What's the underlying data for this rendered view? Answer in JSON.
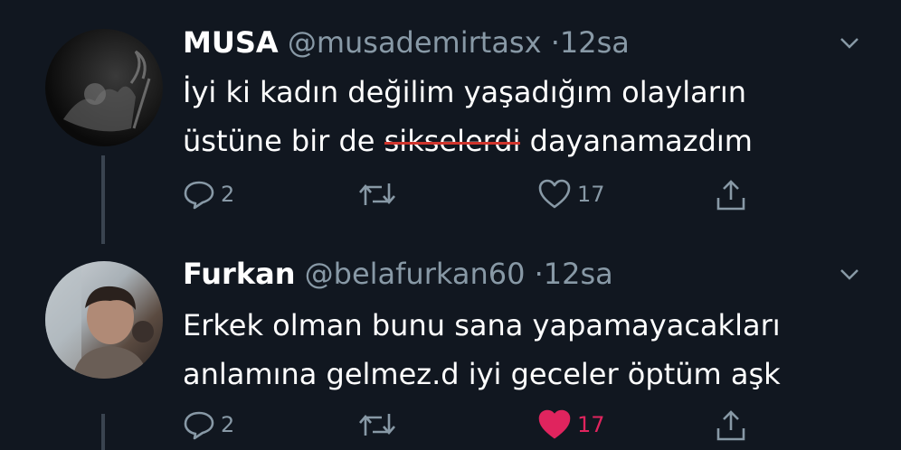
{
  "tweets": [
    {
      "name": "MUSA",
      "handle": "@musademirtasx",
      "separator": "·",
      "time": "12sa",
      "text_part1_line1": "İyi ki kadın değilim yaşadığım olayların",
      "text_part2_line2_prefix": "üstüne bir de ",
      "text_strike": "sikselerdi",
      "text_part3_line2_suffix": " dayanamazdım",
      "replies": "2",
      "likes": "17",
      "liked": false
    },
    {
      "name": "Furkan",
      "handle": "@belafurkan60",
      "separator": "·",
      "time": "12sa",
      "text_line1": "Erkek olman bunu sana yapamayacakları",
      "text_line2": "anlamına gelmez.d iyi geceler öptüm aşk",
      "replies": "2",
      "likes": "17",
      "liked": true
    }
  ],
  "colors": {
    "background": "#111720",
    "secondary_text": "#8899a6",
    "like_active": "#e0245e",
    "thread_line": "#3a4450"
  },
  "icons": [
    "reply-icon",
    "retweet-icon",
    "like-icon",
    "share-icon",
    "chevron-down-icon"
  ]
}
